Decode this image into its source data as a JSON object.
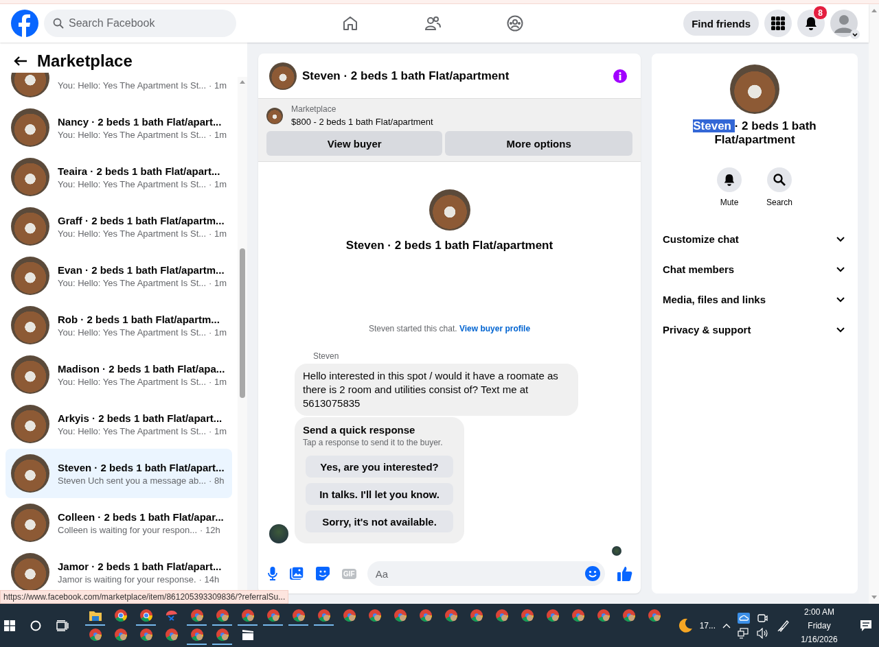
{
  "top_nav": {
    "search": {
      "placeholder": "Search Facebook"
    },
    "find_friends": "Find friends",
    "notification_count": "8"
  },
  "sidebar": {
    "title": "Marketplace",
    "conversations": [
      {
        "preview": "You: Hello: Yes The Apartment Is St...",
        "time": "· 1m",
        "selected": false
      },
      {
        "title": "Nancy · 2 beds 1 bath Flat/apart...",
        "preview": "You: Hello: Yes The Apartment Is St...",
        "time": "· 1m",
        "selected": false
      },
      {
        "title": "Teaira · 2 beds 1 bath Flat/apart...",
        "preview": "You: Hello: Yes The Apartment Is St...",
        "time": "· 1m",
        "selected": false
      },
      {
        "title": "Graff · 2 beds 1 bath Flat/apartm...",
        "preview": "You: Hello: Yes The Apartment Is St...",
        "time": "· 1m",
        "selected": false
      },
      {
        "title": "Evan · 2 beds 1 bath Flat/apartm...",
        "preview": "You: Hello: Yes The Apartment Is St...",
        "time": "· 1m",
        "selected": false
      },
      {
        "title": "Rob · 2 beds 1 bath Flat/apartm...",
        "preview": "You: Hello: Yes The Apartment Is St...",
        "time": "· 1m",
        "selected": false
      },
      {
        "title": "Madison · 2 beds 1 bath Flat/apa...",
        "preview": "You: Hello: Yes The Apartment Is St...",
        "time": "· 1m",
        "selected": false
      },
      {
        "title": "Arkyis · 2 beds 1 bath Flat/apart...",
        "preview": "You: Hello: Yes The Apartment Is St...",
        "time": "· 1m",
        "selected": false
      },
      {
        "title": "Steven · 2 beds 1 bath Flat/apart...",
        "preview": "Steven Uch sent you a message ab...",
        "time": "· 8h",
        "selected": true
      },
      {
        "title": "Colleen · 2 beds 1 bath Flat/apar...",
        "preview": "Colleen is waiting for your respon...",
        "time": "· 12h",
        "selected": false
      },
      {
        "title": "Jamor · 2 beds 1 bath Flat/apart...",
        "preview": "Jamor is waiting for your response.",
        "time": "· 14h",
        "selected": false
      }
    ]
  },
  "status_url": "https://www.facebook.com/marketplace/item/861205393309836/?referralSu...",
  "chat": {
    "title": "Steven · 2 beds 1 bath Flat/apartment",
    "listing": {
      "label": "Marketplace",
      "price_title": "$800 - 2 beds 1 bath Flat/apartment",
      "buttons": [
        "View buyer",
        "More options"
      ]
    },
    "intro_title": "Steven · 2 beds 1 bath Flat/apartment",
    "started_text": "Steven started this chat.",
    "profile_link": "View buyer profile",
    "sender": "Steven",
    "message": "Hello interested in this spot / would it have a roomate as there is 2 room and utilities consist of? Text me at 5613075835",
    "quick_response": {
      "title": "Send a quick response",
      "hint": "Tap a response to send it to the buyer.",
      "options": [
        "Yes, are you interested?",
        "In talks. I'll let you know.",
        "Sorry, it's not available."
      ]
    },
    "composer": {
      "gif_label": "GIF",
      "placeholder": "Aa"
    }
  },
  "details": {
    "title_parts": [
      {
        "text": "Steven ",
        "selected": true
      },
      {
        "text": "· 2 beds 1 bath Flat/apartment",
        "selected": false
      }
    ],
    "actions": [
      {
        "kind": "bell",
        "label": "Mute"
      },
      {
        "kind": "search",
        "label": "Search"
      }
    ],
    "sections": [
      {
        "label": "Customize chat",
        "expanded": false
      },
      {
        "label": "Chat members",
        "expanded": false
      },
      {
        "label": "Media, files and links",
        "expanded": false
      },
      {
        "label": "Privacy & support",
        "expanded": false
      }
    ]
  },
  "taskbar": {
    "apps": [
      {
        "kind": "folder",
        "open": true
      },
      {
        "kind": "chrome",
        "open": false
      },
      {
        "kind": "chrome",
        "open": true
      },
      {
        "kind": "tool",
        "open": false
      },
      {
        "kind": "profile",
        "open": true
      },
      {
        "kind": "profile",
        "open": true
      },
      {
        "kind": "profile",
        "open": true
      },
      {
        "kind": "profile",
        "open": true
      },
      {
        "kind": "profile",
        "open": true
      },
      {
        "kind": "profile",
        "open": true
      },
      {
        "kind": "profile",
        "open": false
      },
      {
        "kind": "profile",
        "open": false
      },
      {
        "kind": "profile",
        "open": false
      },
      {
        "kind": "profile",
        "open": false
      },
      {
        "kind": "profile",
        "open": false
      },
      {
        "kind": "profile",
        "open": false
      },
      {
        "kind": "profile",
        "open": false
      },
      {
        "kind": "profile",
        "open": false
      },
      {
        "kind": "profile",
        "open": false
      },
      {
        "kind": "profile",
        "open": false
      },
      {
        "kind": "profile",
        "open": false
      },
      {
        "kind": "profile",
        "open": false
      },
      {
        "kind": "profile",
        "open": false
      },
      {
        "kind": "profile",
        "open": false
      },
      {
        "kind": "profile",
        "open": false
      },
      {
        "kind": "profile",
        "open": false
      },
      {
        "kind": "profile",
        "open": false
      },
      {
        "kind": "profile",
        "open": true
      },
      {
        "kind": "profile",
        "open": true
      },
      {
        "kind": "clapper",
        "open": false
      }
    ],
    "weather": "17...",
    "time": "2:00 AM",
    "day": "Friday",
    "date": "1/16/2026"
  }
}
